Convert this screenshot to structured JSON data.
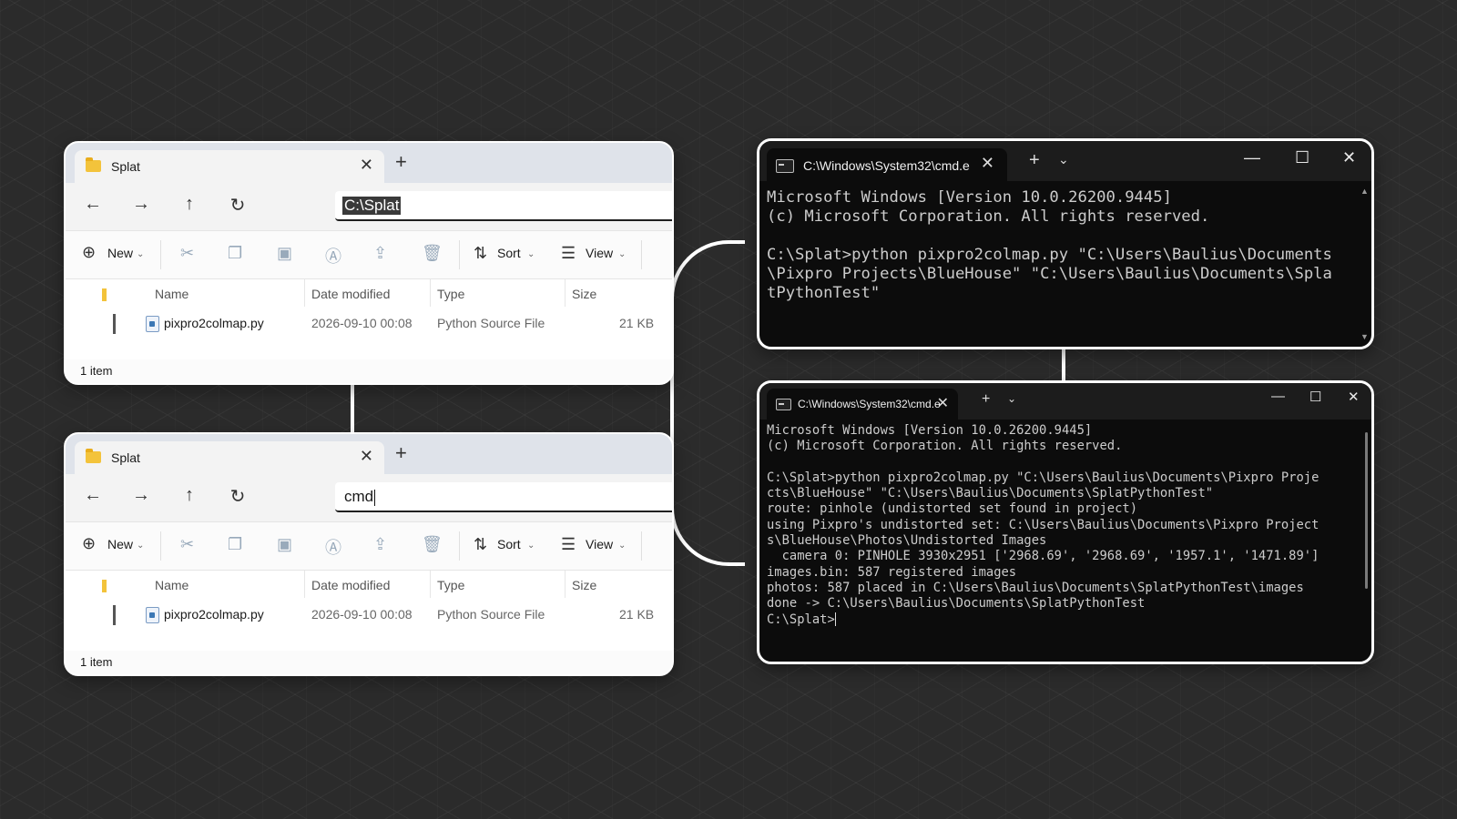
{
  "explorer_top": {
    "tab_title": "Splat",
    "address_value": "C:\\Splat",
    "toolbar": {
      "new": "New",
      "sort": "Sort",
      "view": "View"
    },
    "columns": [
      "Name",
      "Date modified",
      "Type",
      "Size"
    ],
    "file": {
      "name": "pixpro2colmap.py",
      "date": "2026-09-10 00:08",
      "type": "Python Source File",
      "size": "21 KB"
    },
    "status": "1 item"
  },
  "explorer_bottom": {
    "tab_title": "Splat",
    "address_value": "cmd",
    "toolbar": {
      "new": "New",
      "sort": "Sort",
      "view": "View"
    },
    "columns": [
      "Name",
      "Date modified",
      "Type",
      "Size"
    ],
    "file": {
      "name": "pixpro2colmap.py",
      "date": "2026-09-10 00:08",
      "type": "Python Source File",
      "size": "21 KB"
    },
    "status": "1 item"
  },
  "terminal_top": {
    "title": "C:\\Windows\\System32\\cmd.e",
    "output": "Microsoft Windows [Version 10.0.26200.9445]\n(c) Microsoft Corporation. All rights reserved.\n\nC:\\Splat>python pixpro2colmap.py \"C:\\Users\\Baulius\\Documents\n\\Pixpro Projects\\BlueHouse\" \"C:\\Users\\Baulius\\Documents\\Spla\ntPythonTest\""
  },
  "terminal_bottom": {
    "title": "C:\\Windows\\System32\\cmd.e",
    "output": "Microsoft Windows [Version 10.0.26200.9445]\n(c) Microsoft Corporation. All rights reserved.\n\nC:\\Splat>python pixpro2colmap.py \"C:\\Users\\Baulius\\Documents\\Pixpro Proje\ncts\\BlueHouse\" \"C:\\Users\\Baulius\\Documents\\SplatPythonTest\"\nroute: pinhole (undistorted set found in project)\nusing Pixpro's undistorted set: C:\\Users\\Baulius\\Documents\\Pixpro Project\ns\\BlueHouse\\Photos\\Undistorted Images\n  camera 0: PINHOLE 3930x2951 ['2968.69', '2968.69', '1957.1', '1471.89']\nimages.bin: 587 registered images\nphotos: 587 placed in C:\\Users\\Baulius\\Documents\\SplatPythonTest\\images\ndone -> C:\\Users\\Baulius\\Documents\\SplatPythonTest\n",
    "prompt": "C:\\Splat>"
  },
  "icons": {
    "folder": "folder-icon",
    "close": "close-icon",
    "plus": "plus-icon",
    "back": "back-arrow-icon",
    "forward": "forward-arrow-icon",
    "up": "up-arrow-icon",
    "refresh": "refresh-icon",
    "cut": "cut-icon",
    "copy": "copy-icon",
    "paste": "paste-icon",
    "rename": "rename-icon",
    "share": "share-icon",
    "delete": "delete-icon",
    "minimize": "minimize-icon",
    "maximize": "maximize-icon"
  },
  "colors": {
    "background": "#2b2b2b",
    "terminal_bg": "#0c0c0c",
    "terminal_text": "#cccccc",
    "folder": "#f3c33b"
  }
}
